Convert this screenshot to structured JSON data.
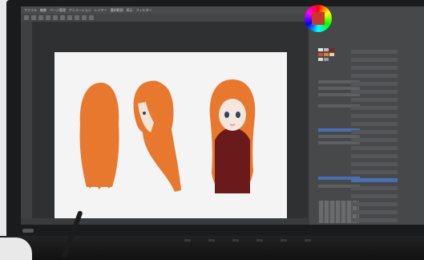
{
  "menubar": {
    "items": [
      "ファイル",
      "編集",
      "ページ管理",
      "アニメーション",
      "レイヤー",
      "選択範囲",
      "表示",
      "フィルター",
      "ウィンドウ",
      "ヘルプ"
    ]
  },
  "canvas": {
    "figures": [
      "character-back-view",
      "character-side-view",
      "character-front-view"
    ],
    "hair_color": "#e8782e",
    "body_color": "#6a1a1a"
  },
  "status": {
    "zoom": ""
  },
  "colors": {
    "screen_bg": "#3b3c3e",
    "panel_bg": "#47484a",
    "canvas_bg": "#f4f4f4"
  }
}
